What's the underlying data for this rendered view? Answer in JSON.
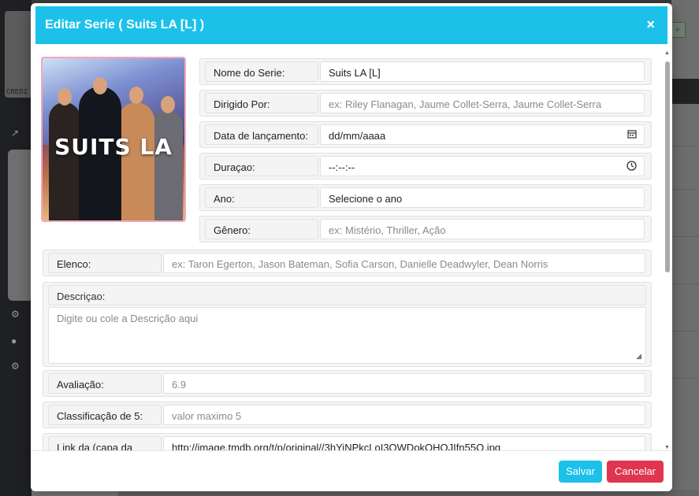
{
  "background": {
    "credit_label": "CREDI"
  },
  "modal": {
    "title": "Editar Serie ( Suits LA [L] )",
    "close_label": "×",
    "poster": {
      "logo_text": "SUITS LA"
    },
    "fields": {
      "nome": {
        "label": "Nome do Serie:",
        "value": "Suits LA [L]"
      },
      "dirigido": {
        "label": "Dirigido Por:",
        "placeholder": "ex: Riley Flanagan, Jaume Collet-Serra, Jaume Collet-Serra"
      },
      "data": {
        "label": "Data de lançamento:",
        "value": "dd/mm/aaaa",
        "icon": "calendar-icon"
      },
      "duracao": {
        "label": "Duraçao:",
        "value": "--:--:--",
        "icon": "clock-icon"
      },
      "ano": {
        "label": "Ano:",
        "value": "Selecione o ano"
      },
      "genero": {
        "label": "Gênero:",
        "placeholder": "ex: Mistério, Thriller, Ação"
      },
      "elenco": {
        "label": "Elenco:",
        "placeholder": "ex: Taron Egerton, Jason Bateman, Sofia Carson, Danielle Deadwyler, Dean Norris"
      },
      "descricao": {
        "label": "Descriçao:",
        "placeholder": "Digite ou cole a Descrição aqui"
      },
      "avaliacao": {
        "label": "Avaliação:",
        "value": "6.9"
      },
      "classificacao": {
        "label": "Classificação de 5:",
        "placeholder": "valor maximo 5"
      },
      "link": {
        "label": "Link da (capa da Serie):",
        "value": "http://image.tmdb.org/t/p/original//3hYiNPkcLoI3QWDokOHQJIfn55O.jpg"
      }
    },
    "buttons": {
      "save": "Salvar",
      "cancel": "Cancelar"
    },
    "colors": {
      "header": "#1cc1ea",
      "save": "#1cc1ea",
      "cancel": "#e0354f"
    }
  }
}
